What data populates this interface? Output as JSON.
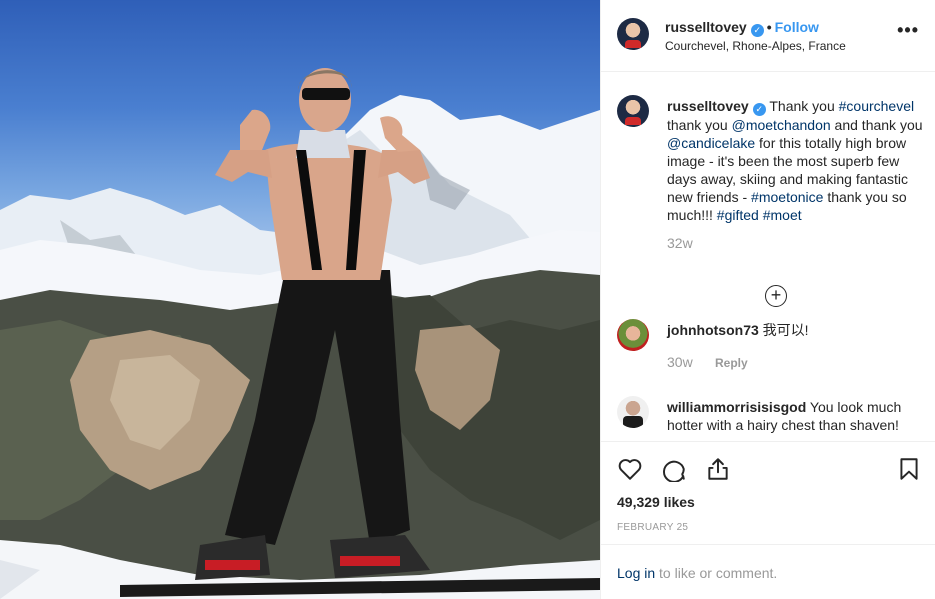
{
  "post": {
    "username": "russelltovey",
    "verified_glyph": "✓",
    "separator": "•",
    "follow_label": "Follow",
    "location": "Courchevel, Rhone-Alpes, France",
    "more_glyph": "•••",
    "photo_icon": "photo-image"
  },
  "caption": {
    "username": "russelltovey",
    "parts": [
      {
        "t": "Thank you ",
        "tag": false
      },
      {
        "t": "#courchevel",
        "tag": true
      },
      {
        "t": " thank you ",
        "tag": false
      },
      {
        "t": "@moetchandon",
        "tag": true
      },
      {
        "t": " and thank you ",
        "tag": false
      },
      {
        "t": "@candicelake",
        "tag": true
      },
      {
        "t": " for this totally high brow image - it's been the most superb few days away, skiing and making fantastic new friends - ",
        "tag": false
      },
      {
        "t": "#moetonice",
        "tag": true
      },
      {
        "t": " thank you so much!!! ",
        "tag": false
      },
      {
        "t": "#gifted",
        "tag": true
      },
      {
        "t": " ",
        "tag": false
      },
      {
        "t": "#moet",
        "tag": true
      }
    ],
    "time": "32w",
    "load_more_glyph": "+"
  },
  "comments": [
    {
      "username": "johnhotson73",
      "text": "我可以!",
      "time": "30w",
      "reply_label": "Reply"
    },
    {
      "username": "williammorrisisisgod",
      "text": "You look much hotter with a hairy chest than shaven!"
    }
  ],
  "actions": {
    "icons": [
      "heart-icon",
      "comment-icon",
      "share-icon",
      "bookmark-icon"
    ],
    "likes": "49,329 likes",
    "date": "FEBRUARY 25"
  },
  "login": {
    "link_label": "Log in",
    "suffix": " to like or comment."
  }
}
